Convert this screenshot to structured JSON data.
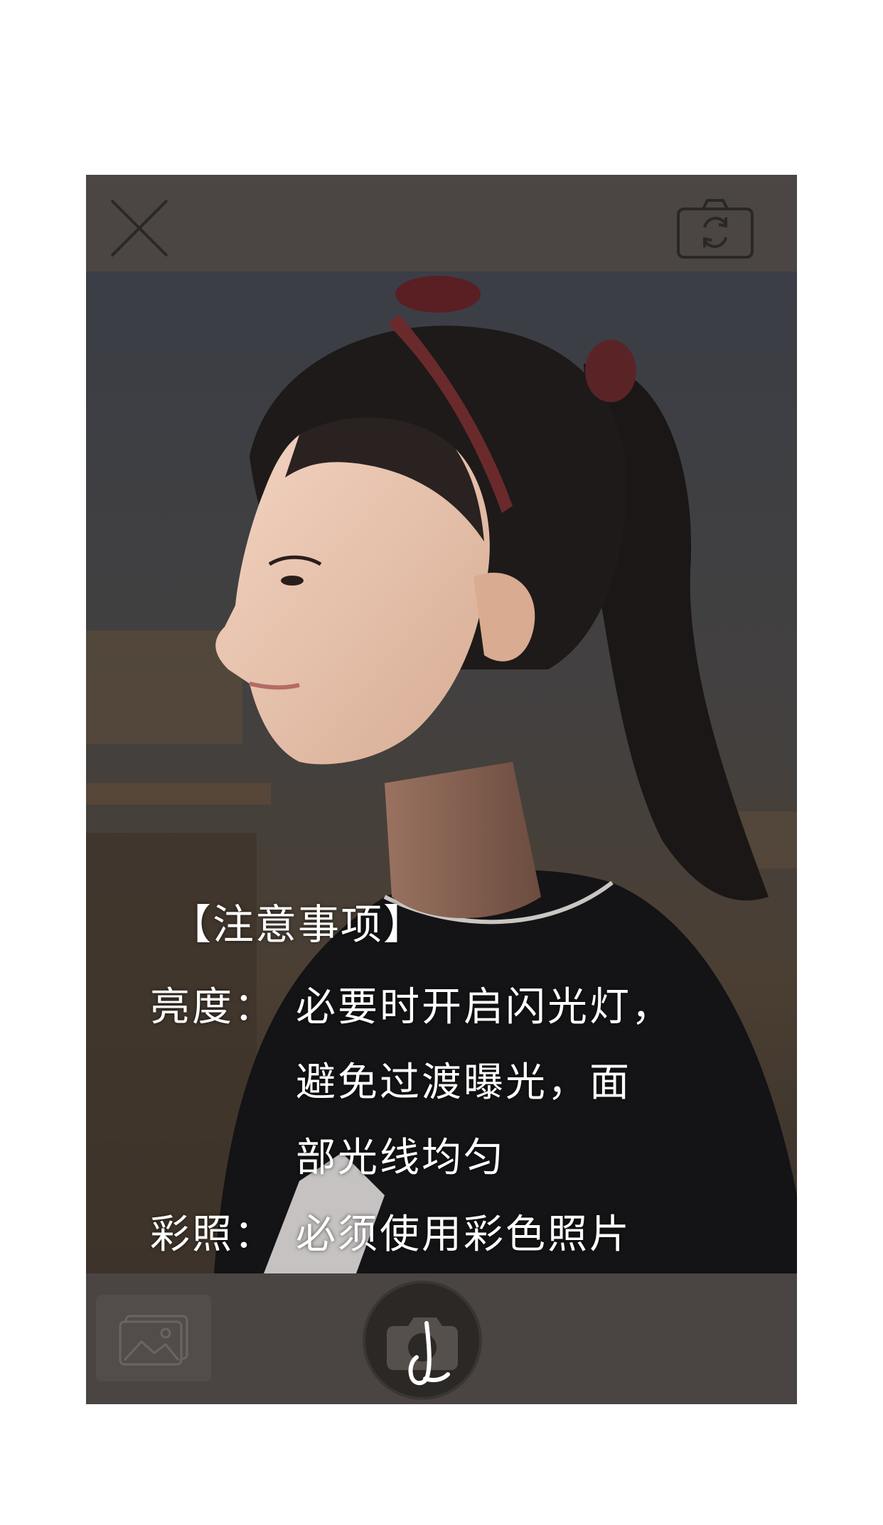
{
  "topbar": {
    "close_icon": "close-icon",
    "flip_camera_icon": "camera-flip-icon"
  },
  "notice": {
    "title": "【注意事项】",
    "brightness_label": "亮度：",
    "brightness_lines": [
      "必要时开启闪光灯，",
      "避免过渡曝光，面",
      "部光线均匀"
    ],
    "color_label": "彩照：",
    "color_text": "必须使用彩色照片"
  },
  "bottombar": {
    "gallery_icon": "gallery-icon",
    "shutter_icon": "camera-shutter-icon"
  },
  "colors": {
    "bar_background": "#4a4542",
    "icon_stroke": "#2a2726",
    "text": "#ffffff"
  }
}
